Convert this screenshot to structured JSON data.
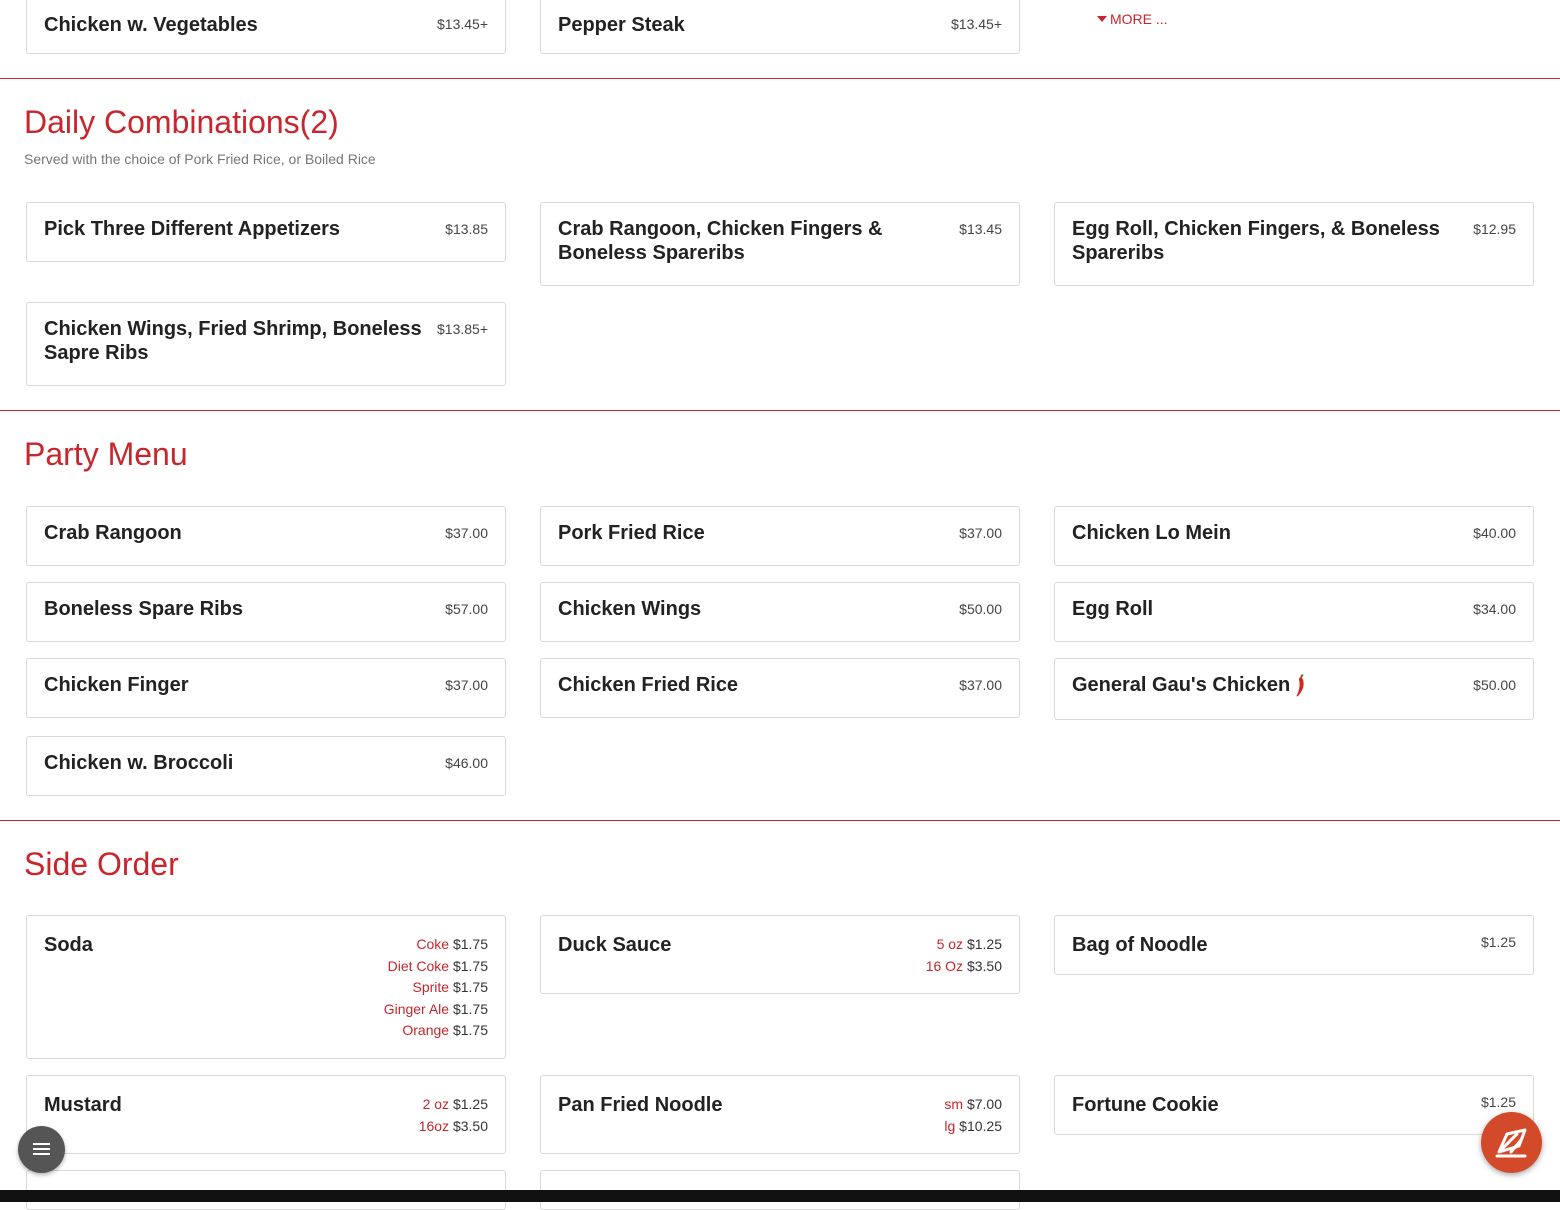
{
  "top_row": {
    "items": [
      {
        "name": "Chicken w. Vegetables",
        "price": "$13.45+"
      },
      {
        "name": "Pepper Steak",
        "price": "$13.45+"
      }
    ],
    "more_label": "MORE ..."
  },
  "daily": {
    "title": "Daily Combinations(2)",
    "subtitle": "Served with the choice of Pork Fried Rice, or Boiled Rice",
    "items": [
      {
        "name": "Pick Three Different Appetizers",
        "price": "$13.85"
      },
      {
        "name": "Crab Rangoon, Chicken Fingers & Boneless Spareribs",
        "price": "$13.45"
      },
      {
        "name": "Egg Roll, Chicken Fingers, & Boneless Spareribs",
        "price": "$12.95"
      },
      {
        "name": "Chicken Wings, Fried Shrimp, Boneless Sapre Ribs",
        "price": "$13.85+"
      }
    ]
  },
  "party": {
    "title": "Party Menu",
    "items": [
      {
        "name": "Crab Rangoon",
        "price": "$37.00"
      },
      {
        "name": "Pork Fried Rice",
        "price": "$37.00"
      },
      {
        "name": "Chicken Lo Mein",
        "price": "$40.00"
      },
      {
        "name": "Boneless Spare Ribs",
        "price": "$57.00"
      },
      {
        "name": "Chicken Wings",
        "price": "$50.00"
      },
      {
        "name": "Egg Roll",
        "price": "$34.00"
      },
      {
        "name": "Chicken Finger",
        "price": "$37.00"
      },
      {
        "name": "Chicken Fried Rice",
        "price": "$37.00"
      },
      {
        "name": "General Gau's Chicken",
        "price": "$50.00",
        "spicy": true
      },
      {
        "name": "Chicken w. Broccoli",
        "price": "$46.00"
      }
    ]
  },
  "side": {
    "title": "Side Order",
    "soda": {
      "name": "Soda",
      "options": [
        {
          "size": "Coke",
          "price": "$1.75"
        },
        {
          "size": "Diet Coke",
          "price": "$1.75"
        },
        {
          "size": "Sprite",
          "price": "$1.75"
        },
        {
          "size": "Ginger Ale",
          "price": "$1.75"
        },
        {
          "size": "Orange",
          "price": "$1.75"
        }
      ]
    },
    "duck_sauce": {
      "name": "Duck Sauce",
      "options": [
        {
          "size": "5 oz",
          "price": "$1.25"
        },
        {
          "size": "16 Oz",
          "price": "$3.50"
        }
      ]
    },
    "bag_of_noodle": {
      "name": "Bag of Noodle",
      "price": "$1.25"
    },
    "mustard": {
      "name": "Mustard",
      "options": [
        {
          "size": "2 oz",
          "price": "$1.25"
        },
        {
          "size": "16oz",
          "price": "$3.50"
        }
      ]
    },
    "pan_fried_noodle": {
      "name": "Pan Fried Noodle",
      "options": [
        {
          "size": "sm",
          "price": "$7.00"
        },
        {
          "size": "lg",
          "price": "$10.25"
        }
      ]
    },
    "fortune_cookie": {
      "name": "Fortune Cookie",
      "price": "$1.25"
    }
  },
  "icons": {
    "menu": "hamburger-menu-icon",
    "order": "order-online-icon",
    "spicy": "chili-pepper-icon",
    "more": "caret-down-icon"
  },
  "colors": {
    "accent": "#c8262c",
    "fab_order": "#d34a2a",
    "fab_menu": "#555555"
  }
}
